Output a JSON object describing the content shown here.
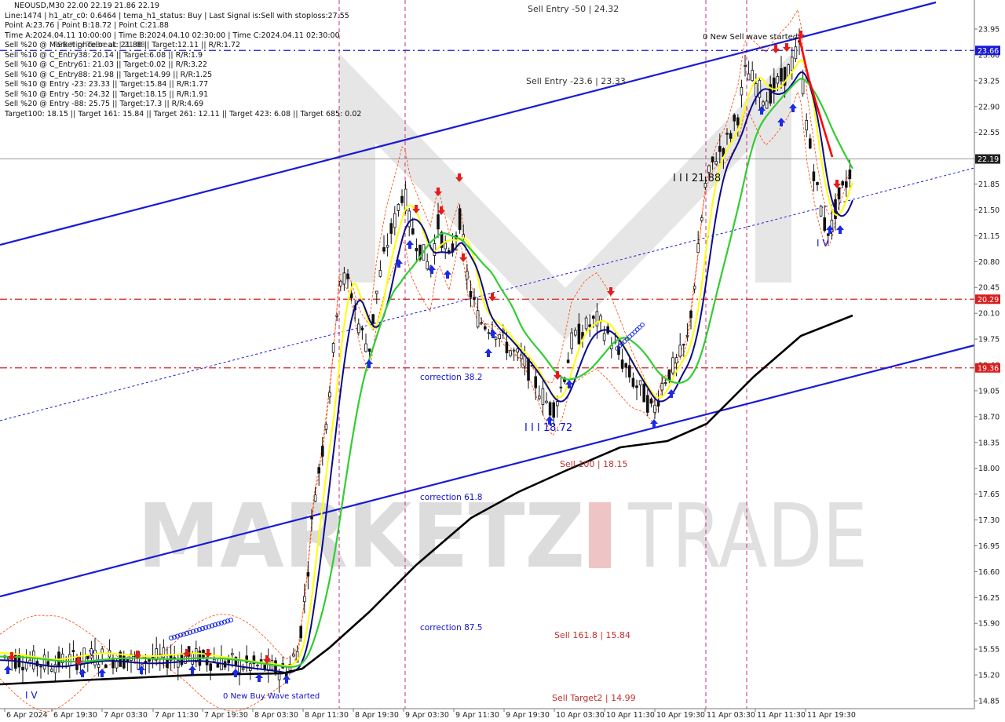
{
  "header": {
    "symbol_line": "NEOUSD,M30  22.00 22.19 21.86 22.19",
    "info_lines": [
      "Line:1474 | h1_atr_c0: 0.6464 | tema_h1_status: Buy | Last Signal is:Sell with stoploss:27.55",
      "Point A:23.76 | Point B:18.72 | Point C:21.88",
      "Time A:2024.04.11 10:00:00 | Time B:2024.04.10 02:30:00 | Time C:2024.04.11 02:30:00",
      "Sell %20 @ Market price or at: 21.88 || Target:12.11 || R/R:1.72",
      "Sell %10 @ C_Entry38: 20.14 || Target:6.08 || R/R:1.9",
      "Sell %10 @ C_Entry61: 21.03 || Target:0.02 || R/R:3.22",
      "Sell %10 @ C_Entry88: 21.98 || Target:14.99 || R/R:1.25",
      "Sell %10 @ Entry -23: 23.33 || Target:15.84 || R/R:1.77",
      "Sell %10 @ Entry -50: 24.32 || Target:18.15 || R/R:1.91",
      "Sell %20 @ Entry -88: 25.75 || Target:17.3 || R/R:4.69",
      "Target100: 18.15 || Target 161: 15.84 || Target 261: 12.11 || Target 423: 6.08 || Target 685: 0.02"
    ],
    "overlay_text": "FSB-HighToBreak | 21.88"
  },
  "annotations": [
    {
      "text": "Sell Entry -50 | 24.32",
      "color": "#333333"
    },
    {
      "text": "0 New Sell wave started",
      "color": "#111111"
    },
    {
      "text": "Sell Entry -23.6 | 23.33",
      "color": "#333333"
    },
    {
      "text": "I I I 21.88",
      "color": "#111111"
    },
    {
      "text": "I V",
      "color": "#1010cc"
    },
    {
      "text": "correction 38.2",
      "color": "#1010cc"
    },
    {
      "text": "I I I 18.72",
      "color": "#1010cc"
    },
    {
      "text": "Sell 100 | 18.15",
      "color": "#c03030"
    },
    {
      "text": "correction 61.8",
      "color": "#1010cc"
    },
    {
      "text": "correction 87.5",
      "color": "#1010cc"
    },
    {
      "text": "Sell 161.8 | 15.84",
      "color": "#c03030"
    },
    {
      "text": "Sell Target2 | 14.99",
      "color": "#c03030"
    },
    {
      "text": "0 New Buy Wave started",
      "color": "#1010cc"
    },
    {
      "text": "V",
      "color": "#1010cc"
    },
    {
      "text": "I V",
      "color": "#1010cc"
    }
  ],
  "watermark": {
    "left": "MARKETZ",
    "mid": "I",
    "right": "TRADE"
  },
  "colors": {
    "candle": "#111111",
    "ma_yellow": "#ffff00",
    "ma_navy": "#0a0a8c",
    "ma_green": "#33cc33",
    "ma_black": "#000000",
    "channel": "#1a1ad6",
    "level_red": "#d81e1e",
    "level_blue": "#1a1ad6",
    "price_current": "#202020",
    "envelope": "#ff4400"
  },
  "chart_data": {
    "type": "candlestick",
    "symbol": "NEOUSD",
    "timeframe": "M30",
    "last_ohlc": {
      "open": 22.0,
      "high": 22.19,
      "low": 21.86,
      "close": 22.19
    },
    "y_ticks": [
      "23.95",
      "23.60",
      "23.25",
      "22.90",
      "22.55",
      "22.19",
      "21.85",
      "21.50",
      "21.15",
      "20.80",
      "20.45",
      "20.10",
      "19.75",
      "19.40",
      "19.05",
      "18.70",
      "18.35",
      "18.00",
      "17.65",
      "17.30",
      "16.95",
      "16.60",
      "16.25",
      "15.90",
      "15.55",
      "15.20",
      "14.85"
    ],
    "x_ticks": [
      "6 Apr 2024",
      "6 Apr 19:30",
      "7 Apr 03:30",
      "7 Apr 11:30",
      "7 Apr 19:30",
      "8 Apr 03:30",
      "8 Apr 11:30",
      "8 Apr 19:30",
      "9 Apr 03:30",
      "9 Apr 11:30",
      "9 Apr 19:30",
      "10 Apr 03:30",
      "10 Apr 11:30",
      "10 Apr 19:30",
      "11 Apr 03:30",
      "11 Apr 11:30",
      "11 Apr 19:30"
    ],
    "price_labels": [
      {
        "value": 23.66,
        "text": "23.66",
        "color": "#1a1ad6"
      },
      {
        "value": 22.19,
        "text": "22.19",
        "color": "#202020"
      },
      {
        "value": 20.29,
        "text": "20.29",
        "color": "#d81e1e"
      },
      {
        "value": 19.36,
        "text": "19.36",
        "color": "#d81e1e"
      }
    ],
    "horizontal_levels": [
      23.66,
      20.29,
      19.36
    ],
    "ylim": [
      14.8,
      24.3
    ]
  }
}
